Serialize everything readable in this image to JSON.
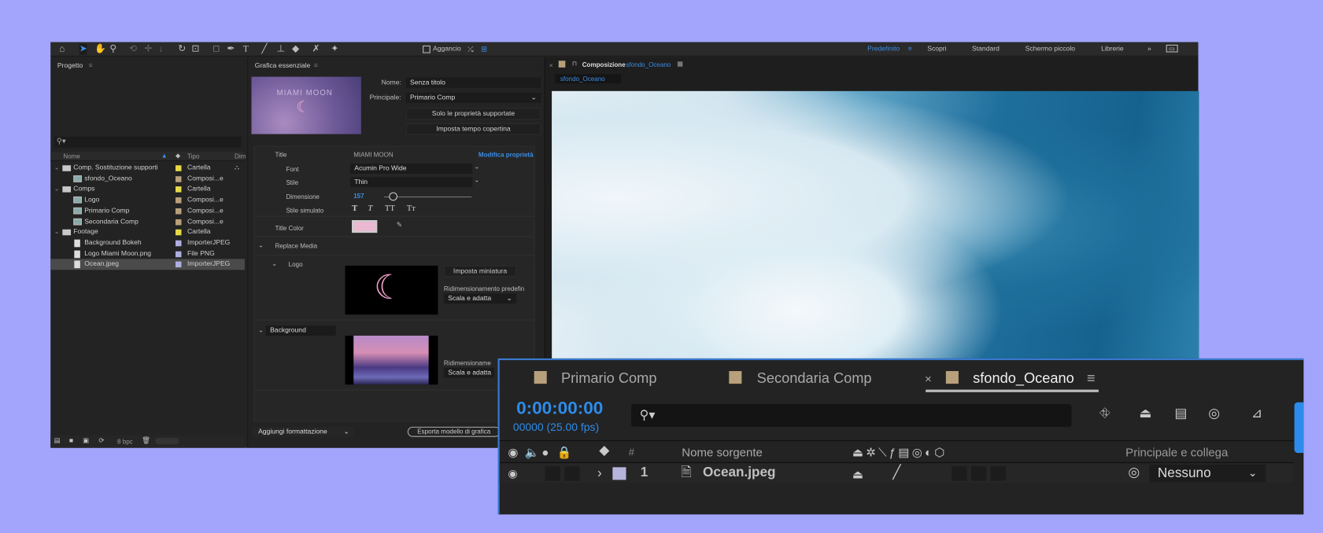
{
  "toolbar": {
    "snap_label": "Aggancio",
    "workspaces": [
      "Predefinito",
      "Scopri",
      "Standard",
      "Schermo piccolo",
      "Librerie"
    ],
    "more": "»",
    "active_workspace": "Predefinito"
  },
  "project": {
    "title": "Progetto",
    "columns": {
      "name": "Nome",
      "type": "Tipo",
      "dim": "Dim"
    },
    "items": [
      {
        "name": "Comp. Sostituzione supporti",
        "type": "Cartella",
        "kind": "folder",
        "color": "#e5d84a"
      },
      {
        "name": "sfondo_Oceano",
        "type": "Composi...e",
        "kind": "comp",
        "color": "#b8a07c"
      },
      {
        "name": "Comps",
        "type": "Cartella",
        "kind": "folder",
        "color": "#e5d84a"
      },
      {
        "name": "Logo",
        "type": "Composi...e",
        "kind": "comp",
        "color": "#b8a07c"
      },
      {
        "name": "Primario Comp",
        "type": "Composi...e",
        "kind": "comp",
        "color": "#b8a07c"
      },
      {
        "name": "Secondaria Comp",
        "type": "Composi...e",
        "kind": "comp",
        "color": "#b8a07c"
      },
      {
        "name": "Footage",
        "type": "Cartella",
        "kind": "folder",
        "color": "#e5d84a"
      },
      {
        "name": "Background Bokeh",
        "type": "ImporterJPEG",
        "kind": "file",
        "color": "#aeaee0"
      },
      {
        "name": "Logo Miami Moon.png",
        "type": "File PNG",
        "kind": "file",
        "color": "#aeaee0"
      },
      {
        "name": "Ocean.jpeg",
        "type": "ImporterJPEG",
        "kind": "file",
        "color": "#aeaee0",
        "selected": true
      }
    ],
    "bpc": "8 bpc"
  },
  "eg": {
    "title": "Grafica essenziale",
    "thumb_text": "MIAMI MOON",
    "name_label": "Nome:",
    "name_value": "Senza titolo",
    "primary_label": "Principale:",
    "primary_value": "Primario Comp",
    "supported_btn": "Solo le proprietà supportate",
    "poster_btn": "Imposta tempo copertina",
    "title_label": "Title",
    "title_value": "MIAMI MOON",
    "edit_props": "Modifica proprietà",
    "font_label": "Font",
    "font_value": "Acumin Pro Wide",
    "style_label": "Stile",
    "style_value": "Thin",
    "size_label": "Dimensione",
    "size_value": "157",
    "faux_label": "Stile simulato",
    "faux": [
      "T",
      "T",
      "TT",
      "Tт"
    ],
    "color_label": "Title Color",
    "title_color": "#ebb8d2",
    "replace_media": "Replace Media",
    "logo_label": "Logo",
    "set_thumb_btn": "Imposta miniatura",
    "resize_label": "Ridimensionamento predefin",
    "resize_value": "Scala e adatta",
    "bg_label": "Background",
    "resize_label2": "Ridimensioname",
    "resize_value2": "Scala e adatta",
    "add_format": "Aggiungi formattazione",
    "export_btn": "Esporta modello di grafica"
  },
  "comp": {
    "title_prefix": "Composizione",
    "title_name": "sfondo_Oceano",
    "subtab": "sfondo_Oceano"
  },
  "timeline": {
    "tabs": [
      "Primario Comp",
      "Secondaria Comp",
      "sfondo_Oceano"
    ],
    "active_tab": "sfondo_Oceano",
    "timecode": "0:00:00:00",
    "frames": "00000 (25.00 fps)",
    "search_placeholder": "",
    "col_num": "#",
    "col_source": "Nome sorgente",
    "col_parent": "Principale e collega",
    "layers": [
      {
        "num": "1",
        "name": "Ocean.jpeg",
        "parent": "Nessuno",
        "label_color": "#b4b4dc"
      }
    ]
  },
  "colors": {
    "accent": "#2d8ceb",
    "bg": "#a2a5fb",
    "panel": "#232323"
  }
}
